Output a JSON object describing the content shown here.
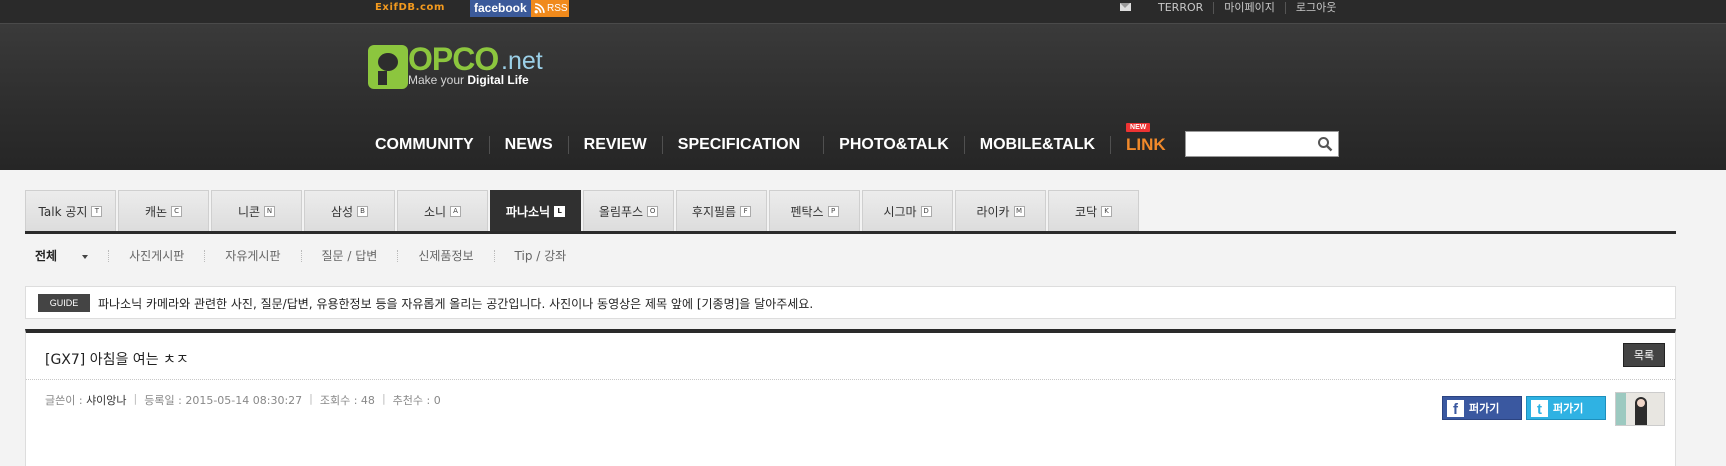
{
  "topbar": {
    "exif": "ExifDB.com",
    "facebook": "facebook",
    "rss": "RSS",
    "links": [
      "TERROR",
      "마이페이지",
      "로그아웃"
    ]
  },
  "logo": {
    "opco": "OPCO",
    "net": ".net",
    "tagline_pre": "Make your ",
    "tagline_bold": "Digital Life"
  },
  "mainnav": {
    "items": [
      "COMMUNITY",
      "NEWS",
      "REVIEW",
      "SPECIFICATION",
      "PHOTO&TALK",
      "MOBILE&TALK"
    ],
    "link": "LINK",
    "new_badge": "NEW"
  },
  "search": {
    "value": ""
  },
  "brand_tabs": [
    {
      "label": "Talk 공지",
      "key": "T"
    },
    {
      "label": "캐논",
      "key": "C"
    },
    {
      "label": "니콘",
      "key": "N"
    },
    {
      "label": "삼성",
      "key": "B"
    },
    {
      "label": "소니",
      "key": "A"
    },
    {
      "label": "파나소닉",
      "key": "L"
    },
    {
      "label": "올림푸스",
      "key": "O"
    },
    {
      "label": "후지필름",
      "key": "F"
    },
    {
      "label": "펜탁스",
      "key": "P"
    },
    {
      "label": "시그마",
      "key": "D"
    },
    {
      "label": "라이카",
      "key": "M"
    },
    {
      "label": "코닥",
      "key": "K"
    }
  ],
  "active_tab": "파나소닉",
  "sub_tabs": [
    "전체",
    "사진게시판",
    "자유게시판",
    "질문 / 답변",
    "신제품정보",
    "Tip / 강좌"
  ],
  "guide": {
    "badge": "GUIDE",
    "text": "파나소닉 카메라와 관련한 사진, 질문/답변, 유용한정보 등을 자유롭게 올리는 공간입니다. 사진이나 동영상은 제목 앞에 [기종명]을 달아주세요."
  },
  "post": {
    "title": "[GX7] 아침을 여는 ㅊㅈ",
    "list_button": "목록",
    "author_label": "글쓴이 :",
    "author": "샤이앙나",
    "date_label": "등록일 : 2015-05-14 08:30:27",
    "views_label": "조회수 : 48",
    "recommend_label": "추천수 : 0",
    "share_fb": "퍼가기",
    "share_tw": "퍼가기"
  },
  "colors": {
    "accent_orange": "#f1892a",
    "brand_green": "#8cc63e",
    "facebook_blue": "#3a58a0",
    "twitter_blue": "#2fb2e3"
  }
}
